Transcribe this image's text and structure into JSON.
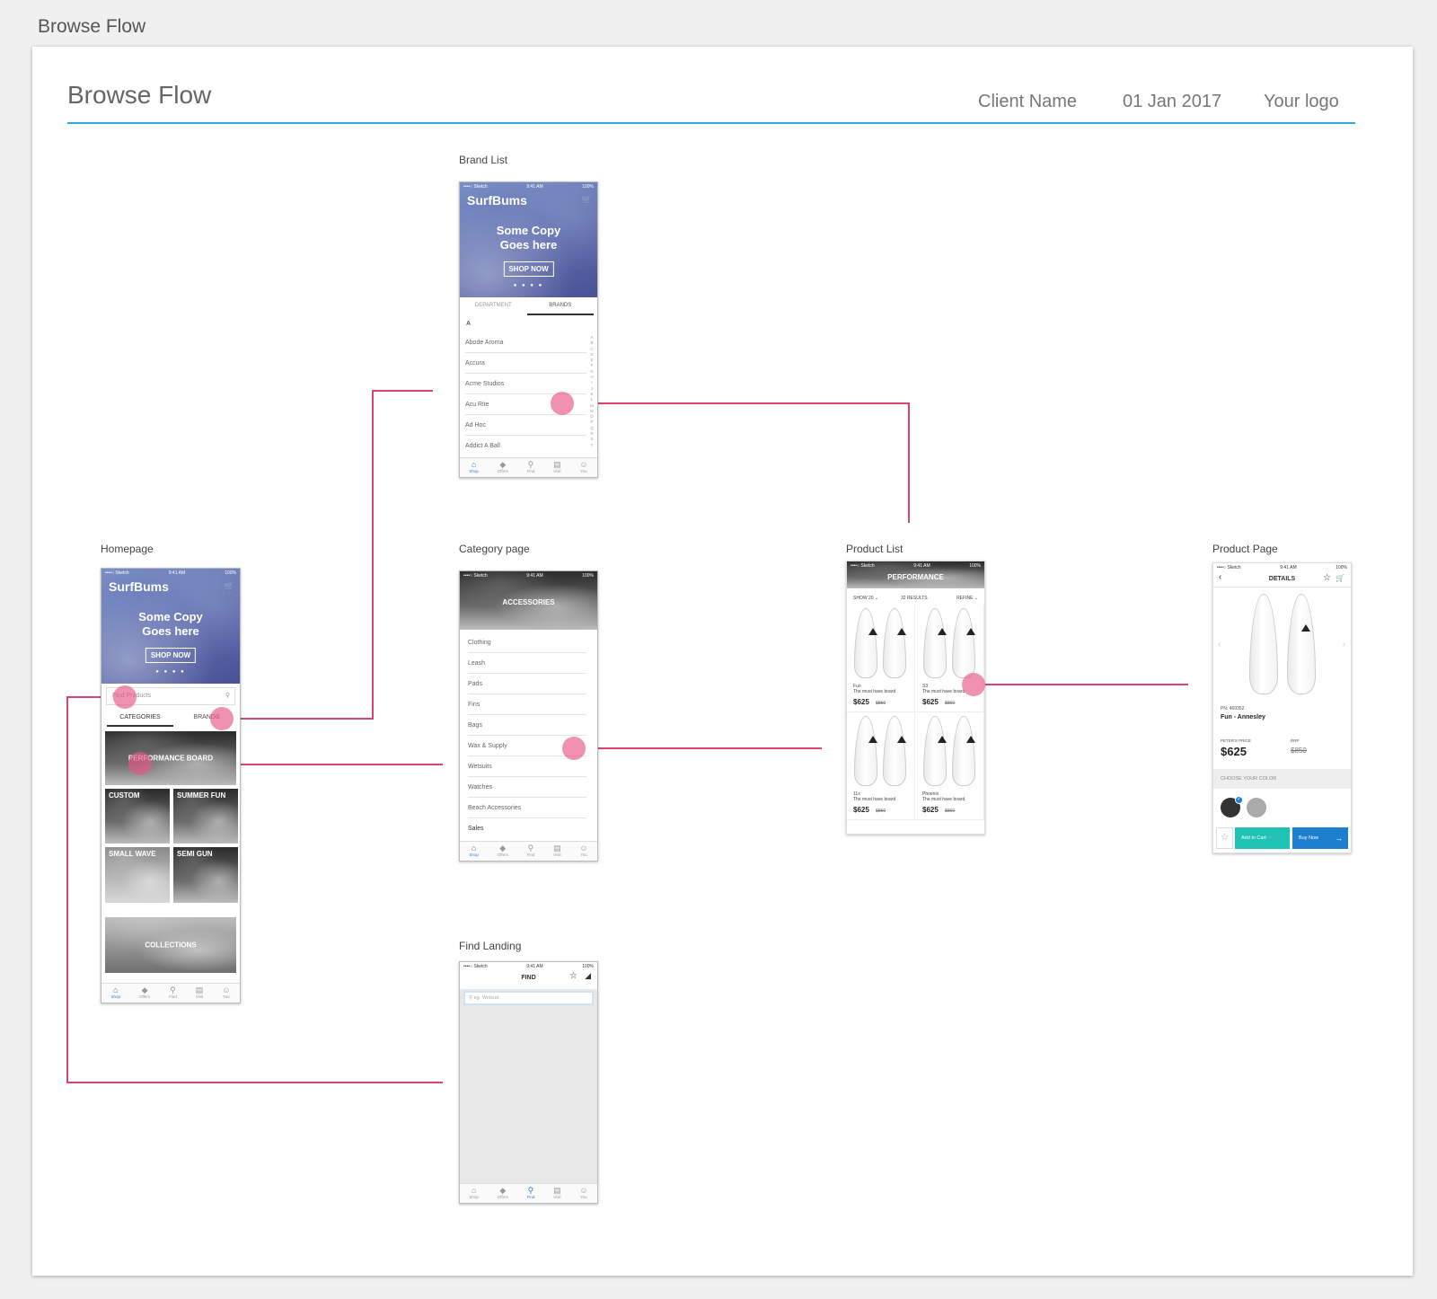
{
  "page": {
    "outer_title": "Browse Flow"
  },
  "board": {
    "title": "Browse Flow",
    "client_name": "Client Name",
    "date": "01 Jan 2017",
    "logo": "Your logo",
    "accent_color": "#31a6e6",
    "link_color": "#d9456f"
  },
  "status_bar": {
    "carrier": "••••○ Sketch",
    "time": "9:41 AM",
    "battery": "100%"
  },
  "tabbar": {
    "items": [
      "Shop",
      "Offers",
      "Find",
      "Visit",
      "You"
    ]
  },
  "hero": {
    "brand": "SurfBums",
    "copy_line1": "Some Copy",
    "copy_line2": "Goes here",
    "cta": "SHOP NOW"
  },
  "brand_list": {
    "label": "Brand List",
    "tabs": [
      "DEPARTMENT",
      "BRANDS"
    ],
    "section_letter": "A",
    "brands": [
      "Abode Aroma",
      "Accura",
      "Acme Studios",
      "Acu Rite",
      "Ad Hoc",
      "Addict A Ball"
    ],
    "alphabet": [
      "A",
      "B",
      "C",
      "D",
      "E",
      "F",
      "G",
      "H",
      "I",
      "J",
      "K",
      "L",
      "M",
      "N",
      "O",
      "P",
      "Q",
      "R",
      "S",
      "T"
    ]
  },
  "homepage": {
    "label": "Homepage",
    "search_placeholder": "Find Products",
    "tabs": [
      "CATEGORIES",
      "BRANDS"
    ],
    "featured": "PERFORMANCE BOARD",
    "tiles": [
      "CUSTOM",
      "SUMMER FUN",
      "SMALL WAVE",
      "SEMI GUN"
    ],
    "collections": "COLLECTIONS"
  },
  "category_page": {
    "label": "Category page",
    "banner": "ACCESSORIES",
    "items": [
      "Clothing",
      "Leash",
      "Pads",
      "Fins",
      "Bags",
      "Wax & Supply",
      "Wetsuits",
      "Watches",
      "Beach Accessories",
      "Sales"
    ]
  },
  "product_list": {
    "label": "Product List",
    "banner": "PERFORMANCE",
    "show": "SHOW 20",
    "results": "32 RESULTS",
    "refine": "REFINE",
    "products": [
      {
        "name": "Fun",
        "tagline": "The must have board",
        "price": "$625",
        "was": "$850"
      },
      {
        "name": "S3",
        "tagline": "The must have board",
        "price": "$625",
        "was": "$850"
      },
      {
        "name": "11x",
        "tagline": "The must have board",
        "price": "$625",
        "was": "$850"
      },
      {
        "name": "Phoenix",
        "tagline": "The must have board",
        "price": "$625",
        "was": "$850"
      }
    ]
  },
  "product_page": {
    "label": "Product Page",
    "header": "DETAILS",
    "pn": "PN: 469352",
    "name": "Fun - Annesley",
    "price_label": "PETER'S PRICE",
    "price": "$625",
    "rrp_label": "RRP",
    "rrp": "$850",
    "color_label": "CHOOSE YOUR COLOR",
    "add_to_cart": "Add to Cart",
    "buy_now": "Buy Now",
    "teal": "#1fc3b5",
    "blue": "#1c7fd0"
  },
  "find_landing": {
    "label": "Find Landing",
    "header": "FIND",
    "search_placeholder": "eg. Wetsuit"
  }
}
